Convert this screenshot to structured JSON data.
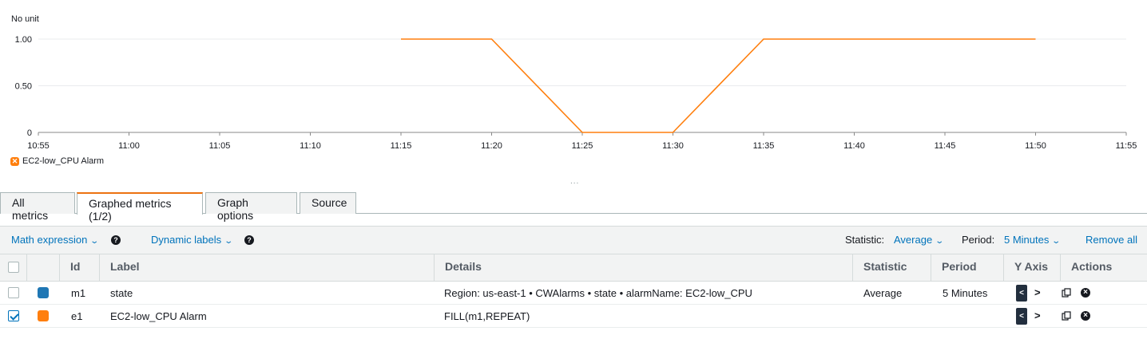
{
  "chart_data": {
    "type": "line",
    "unit_label": "No unit",
    "x": [
      "10:55",
      "11:00",
      "11:05",
      "11:10",
      "11:15",
      "11:20",
      "11:25",
      "11:30",
      "11:35",
      "11:40",
      "11:45",
      "11:50",
      "11:55"
    ],
    "yticks": [
      "0",
      "0.50",
      "1.00"
    ],
    "ylim": [
      0,
      1
    ],
    "grid": true,
    "legend_position": "bottom-left",
    "series": [
      {
        "name": "EC2-low_CPU Alarm",
        "color": "#ff7f0e",
        "points": [
          [
            "11:15",
            1
          ],
          [
            "11:20",
            1
          ],
          [
            "11:25",
            0
          ],
          [
            "11:30",
            0
          ],
          [
            "11:35",
            1
          ],
          [
            "11:40",
            1
          ],
          [
            "11:45",
            1
          ],
          [
            "11:50",
            1
          ]
        ]
      }
    ]
  },
  "legend": {
    "label": "EC2-low_CPU Alarm",
    "icon": "x-mark-icon",
    "color": "#ff7f0e"
  },
  "resize_handle": "...",
  "tabs": [
    {
      "label": "All metrics",
      "active": false
    },
    {
      "label": "Graphed metrics (1/2)",
      "active": true
    },
    {
      "label": "Graph options",
      "active": false
    },
    {
      "label": "Source",
      "active": false
    }
  ],
  "toolbar": {
    "math_expression": "Math expression",
    "dynamic_labels": "Dynamic labels",
    "statistic_label": "Statistic:",
    "statistic_value": "Average",
    "period_label": "Period:",
    "period_value": "5 Minutes",
    "remove_all": "Remove all"
  },
  "table": {
    "headers": {
      "id": "Id",
      "label": "Label",
      "details": "Details",
      "statistic": "Statistic",
      "period": "Period",
      "y_axis": "Y Axis",
      "actions": "Actions"
    },
    "rows": [
      {
        "checked": false,
        "color": "#1f77b4",
        "id": "m1",
        "label": "state",
        "details": "Region: us-east-1 • CWAlarms • state • alarmName: EC2-low_CPU",
        "statistic": "Average",
        "period": "5 Minutes"
      },
      {
        "checked": true,
        "color": "#ff7f0e",
        "id": "e1",
        "label": "EC2-low_CPU Alarm",
        "details": "FILL(m1,REPEAT)",
        "statistic": "",
        "period": ""
      }
    ]
  },
  "colors": {
    "accent_link": "#0073bb",
    "active_tab": "#ec7211"
  }
}
